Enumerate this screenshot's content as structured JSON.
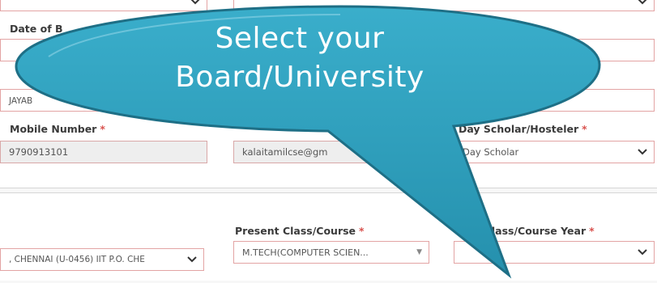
{
  "form": {
    "dob_label": "Date of B",
    "name_partial": "JAYAB",
    "mobile_label": "Mobile Number",
    "mobile_value": "9790913101",
    "email_value": "kalaitamilcse@gm",
    "scholar_label": "Day Scholar/Hosteler",
    "scholar_value": "Day Scholar",
    "institution_value": ", CHENNAI (U-0456) IIT P.O. CHE",
    "present_class_label": "Present Class/Course",
    "present_class_value": "M.TECH(COMPUTER SCIEN...",
    "present_year_label": "ent Class/Course Year",
    "required_mark": "*"
  },
  "callout": {
    "line1": "Select your",
    "line2": "Board/University"
  },
  "colors": {
    "bubble_fill": "#2b9fbd",
    "bubble_stroke": "#1e6f86",
    "required": "#d9534f",
    "field_border": "#e3a4a4"
  },
  "icons": [
    "chevron-down-icon",
    "caret-down-icon"
  ]
}
